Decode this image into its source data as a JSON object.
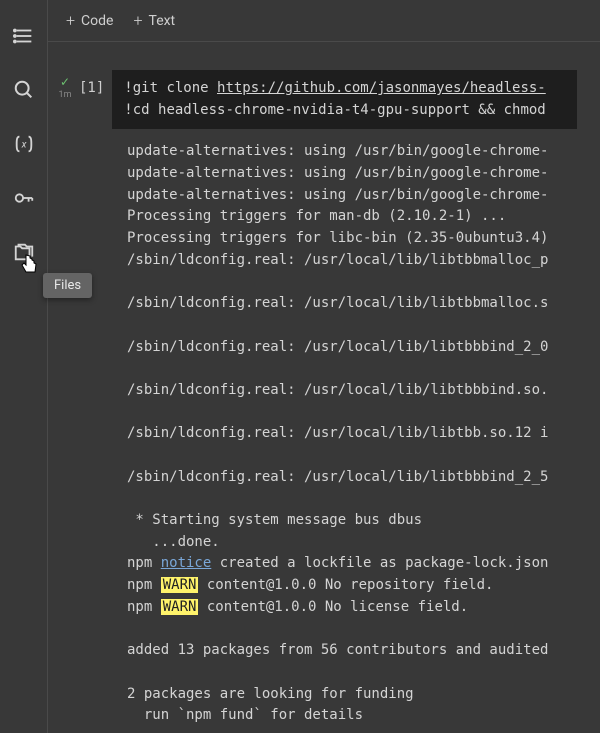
{
  "toolbar": {
    "code_label": "Code",
    "text_label": "Text"
  },
  "sidebar": {
    "tooltip": "Files"
  },
  "cell": {
    "execution_count": "[1]",
    "timing": "1m",
    "code_line1_prefix": "!git clone ",
    "code_line1_url": "https://github.com/jasonmayes/headless-",
    "code_line2": "!cd headless-chrome-nvidia-t4-gpu-support && chmod"
  },
  "output": {
    "lines": [
      "update-alternatives: using /usr/bin/google-chrome-",
      "update-alternatives: using /usr/bin/google-chrome-",
      "update-alternatives: using /usr/bin/google-chrome-",
      "Processing triggers for man-db (2.10.2-1) ...",
      "Processing triggers for libc-bin (2.35-0ubuntu3.4)",
      "/sbin/ldconfig.real: /usr/local/lib/libtbbmalloc_p",
      "",
      "/sbin/ldconfig.real: /usr/local/lib/libtbbmalloc.s",
      "",
      "/sbin/ldconfig.real: /usr/local/lib/libtbbbind_2_0",
      "",
      "/sbin/ldconfig.real: /usr/local/lib/libtbbbind.so.",
      "",
      "/sbin/ldconfig.real: /usr/local/lib/libtbb.so.12 i",
      "",
      "/sbin/ldconfig.real: /usr/local/lib/libtbbbind_2_5",
      "",
      " * Starting system message bus dbus",
      "   ...done."
    ],
    "npm_notice_prefix": "npm ",
    "npm_notice_word": "notice",
    "npm_notice_rest": " created a lockfile as package-lock.json",
    "npm_warn1_prefix": "npm ",
    "npm_warn1_word": "WARN",
    "npm_warn1_rest": " content@1.0.0 No repository field.",
    "npm_warn2_prefix": "npm ",
    "npm_warn2_word": "WARN",
    "npm_warn2_rest": " content@1.0.0 No license field.",
    "tail": [
      "",
      "added 13 packages from 56 contributors and audited",
      "",
      "2 packages are looking for funding",
      "  run `npm fund` for details"
    ]
  }
}
